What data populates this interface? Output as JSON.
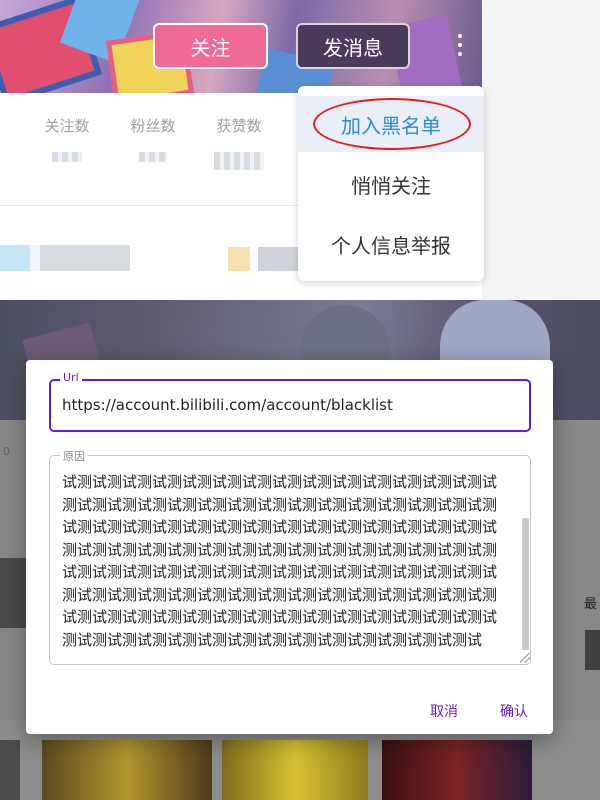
{
  "profile": {
    "follow_button": "关注",
    "message_button": "发消息",
    "more_icon": "more-vertical-icon",
    "stats": [
      {
        "label": "关注数"
      },
      {
        "label": "粉丝数"
      },
      {
        "label": "获赞数"
      }
    ]
  },
  "dropdown": {
    "items": [
      "加入黑名单",
      "悄悄关注",
      "个人信息举报"
    ],
    "highlight_color": "#2d8bd8",
    "annotation_color": "#e02020"
  },
  "dialog": {
    "url_label": "Url",
    "url_value": "https://account.bilibili.com/account/blacklist",
    "reason_label": "原因",
    "reason_text": "试测试测试测试测试测试测试测试测试测试测试测试测试测试测试测试测试测试测试测试测试测试测试测试测试测试测试测试测试测试测试测试测试测试测试测试测试测试测试测试测试测试测试测试测试测试测试测试测试测试测试测试测试测试测试测试测试测试测试测试测试测试测试测试测试测试测试测试测试测试测试测试测试测试测试测试测试测试测试测试测试测试测试测试测试测试测试测试测试测试测试测试测试测试测试测试测试测试测试测试测试测试测试测试测试测试测试测试测试测试测试测试测试测试测试测试",
    "cancel": "取消",
    "confirm": "确认",
    "accent_color": "#6a1bd6"
  },
  "background": {
    "side_text": "最",
    "side_number": "0"
  }
}
